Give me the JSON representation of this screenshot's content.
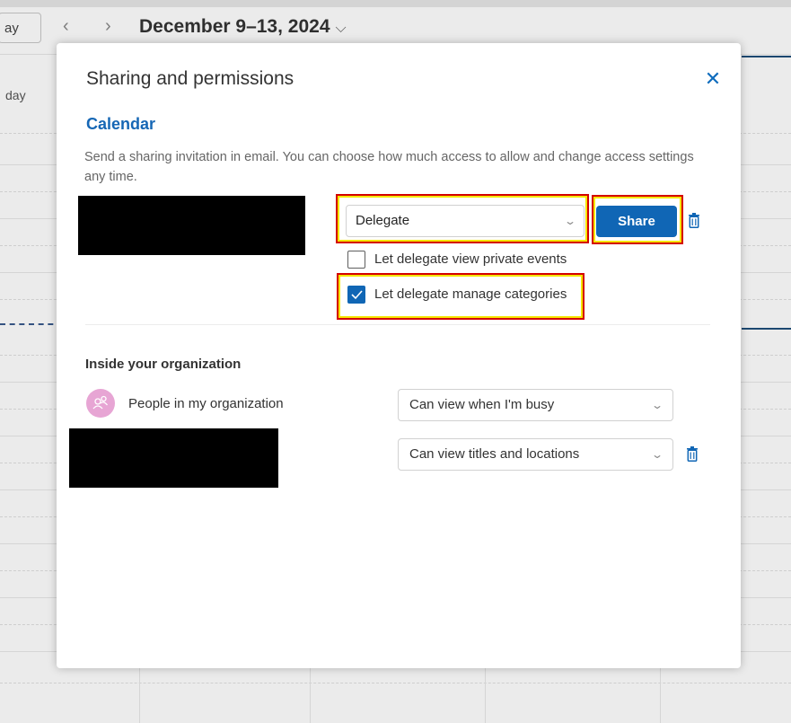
{
  "background": {
    "today_button_label": "ay",
    "date_range": "December 9–13, 2024",
    "day_label": "day"
  },
  "dialog": {
    "title": "Sharing and permissions",
    "section_title": "Calendar",
    "description": "Send a sharing invitation in email. You can choose how much access to allow and change access settings any time.",
    "permission_select_value": "Delegate",
    "share_button_label": "Share",
    "checkboxes": [
      {
        "label": "Let delegate view private events",
        "checked": false
      },
      {
        "label": "Let delegate manage categories",
        "checked": true
      }
    ],
    "inside_org_title": "Inside your organization",
    "org_row": {
      "label": "People in my organization",
      "permission": "Can view when I'm busy"
    },
    "second_row_permission": "Can view titles and locations"
  },
  "colors": {
    "accent": "#1066b5",
    "highlight_border": "#d40000",
    "highlight_glow": "#f5e600",
    "avatar": "#e7a5d4"
  },
  "icons": [
    "close-icon",
    "chevron-down-icon",
    "trash-icon",
    "checkmark-icon",
    "people-icon",
    "chevron-left-icon",
    "chevron-right-icon"
  ]
}
